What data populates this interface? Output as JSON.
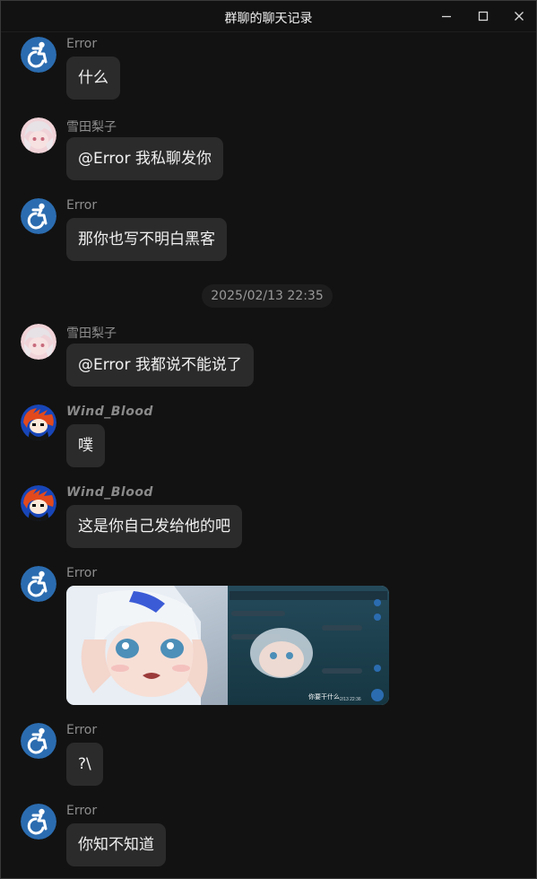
{
  "window": {
    "title": "群聊的聊天记录",
    "minimize_icon": "minimize-icon",
    "maximize_icon": "maximize-icon",
    "close_icon": "close-icon"
  },
  "timestamp": "2025/02/13 22:35",
  "colors": {
    "background": "#121212",
    "bubble": "#2b2b2b",
    "sender_text": "#8e8e8e",
    "error_avatar_bg": "#2b6cb0",
    "accessibility_blue": "#1f6fb2"
  },
  "messages": [
    {
      "sender": "Error",
      "avatar": "wheelchair-avatar",
      "text": "什么"
    },
    {
      "sender": "雪田梨子",
      "avatar": "anime-girl-avatar",
      "text": "@Error 我私聊发你"
    },
    {
      "sender": "Error",
      "avatar": "wheelchair-avatar",
      "text": "那你也写不明白黑客"
    },
    {
      "sender": "雪田梨子",
      "avatar": "anime-girl-avatar",
      "text": "@Error 我都说不能说了"
    },
    {
      "sender": "Wind_Blood",
      "avatar": "red-hair-character-avatar",
      "text": "噗"
    },
    {
      "sender": "Wind_Blood",
      "avatar": "red-hair-character-avatar",
      "text": "这是你自己发给他的吧"
    },
    {
      "sender": "Error",
      "avatar": "wheelchair-avatar",
      "text": "",
      "image": "shared-screenshot-image"
    },
    {
      "sender": "Error",
      "avatar": "wheelchair-avatar",
      "text": "?\\"
    },
    {
      "sender": "Error",
      "avatar": "wheelchair-avatar",
      "text": "你知不知道"
    }
  ],
  "embedded_screenshot": {
    "caption": "你要干什么",
    "time": "2/13 22:36"
  }
}
